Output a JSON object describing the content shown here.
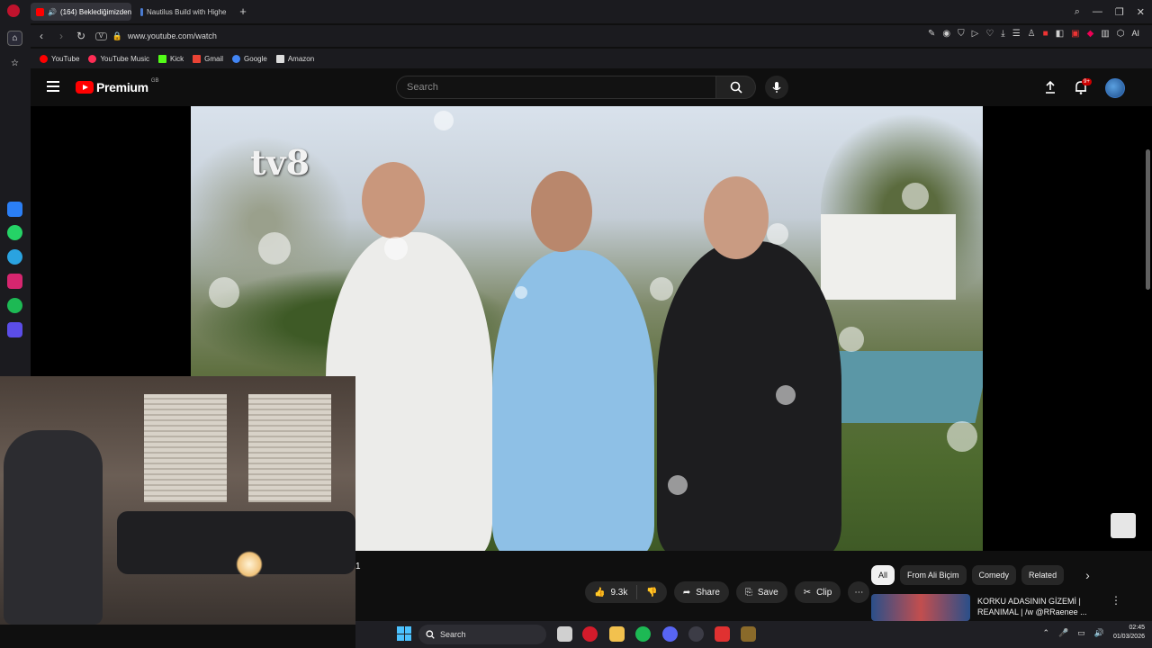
{
  "browser": {
    "tabs": [
      {
        "label": "(164) Beklediğimizden",
        "active": true
      },
      {
        "label": "Nautilus Build with Highe",
        "active": false
      }
    ],
    "url_pill": "V",
    "url": "www.youtube.com/watch",
    "ai_label": "AI",
    "bookmarks": [
      {
        "label": "YouTube",
        "color": "#ff0000"
      },
      {
        "label": "YouTube Music",
        "color": "#ff2d55"
      },
      {
        "label": "Kick",
        "color": "#53fc18"
      },
      {
        "label": "Gmail",
        "color": "#ea4335"
      },
      {
        "label": "Google",
        "color": "#4285f4"
      },
      {
        "label": "Amazon",
        "color": "#dddddd"
      }
    ]
  },
  "youtube": {
    "logo_text": "Premium",
    "region": "GB",
    "search_placeholder": "Search",
    "notification_badge": "9+",
    "video": {
      "channel_bug": "tv8"
    },
    "actions": {
      "likes": "9.3k",
      "share": "Share",
      "save": "Save",
      "clip": "Clip"
    },
    "chips": [
      "All",
      "From Ali Biçim",
      "Comedy",
      "Related"
    ],
    "recommendation": {
      "title": "KORKU ADASININ GİZEMİ | REANIMAL | /w @RRaenee ..."
    }
  },
  "overlay": {
    "cursor_text": "1"
  },
  "taskbar": {
    "search_placeholder": "Search",
    "time": "02:45",
    "date": "01/03/2026"
  },
  "colors": {
    "accent_red": "#ff0000",
    "chip_active": "#f1f1f1",
    "page_bg": "#0f0f0f"
  }
}
